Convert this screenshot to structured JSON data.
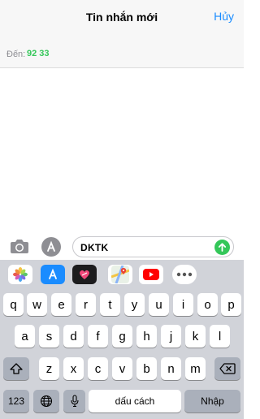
{
  "nav": {
    "title": "Tin nhắn mới",
    "cancel": "Hủy"
  },
  "recipient": {
    "label": "Đến:",
    "value": "92 33"
  },
  "compose": {
    "text": "DKTK"
  },
  "app_strip": {
    "icons": [
      "photos-icon",
      "app-store-icon",
      "digital-touch-icon",
      "maps-icon",
      "youtube-icon",
      "more-icon"
    ]
  },
  "keyboard": {
    "row1": [
      "q",
      "w",
      "e",
      "r",
      "t",
      "y",
      "u",
      "i",
      "o",
      "p"
    ],
    "row2": [
      "a",
      "s",
      "d",
      "f",
      "g",
      "h",
      "j",
      "k",
      "l"
    ],
    "row3": [
      "z",
      "x",
      "c",
      "v",
      "b",
      "n",
      "m"
    ],
    "numbers_label": "123",
    "space_label": "dấu cách",
    "return_label": "Nhập"
  },
  "colors": {
    "accent": "#1a8cff",
    "green": "#34c759",
    "keyboard_bg": "#d1d3d9"
  }
}
